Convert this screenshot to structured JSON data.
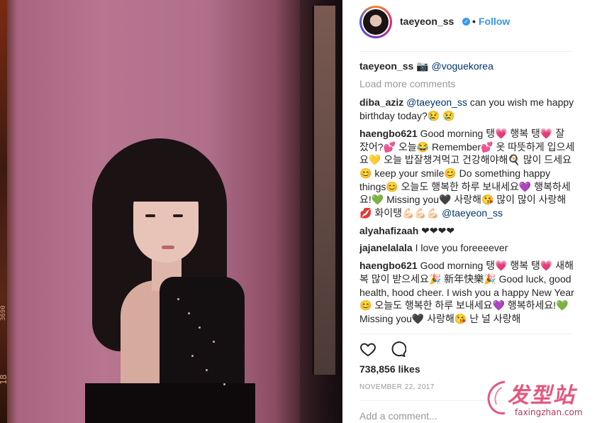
{
  "post": {
    "username": "taeyeon_ss",
    "follow_label": "Follow",
    "caption_user": "taeyeon_ss",
    "caption_emoji": "📷",
    "caption_mention": "@voguekorea",
    "load_more": "Load more comments",
    "likes": "738,856 likes",
    "date": "NOVEMBER 22, 2017",
    "add_comment_placeholder": "Add a comment..."
  },
  "comments": [
    {
      "user": "diba_aziz",
      "mention": "@taeyeon_ss",
      "text": " can you wish me happy birthday today?😢 😢"
    },
    {
      "user": "haengbo621",
      "text": " Good morning 탱💗 행복 탱💗 잘 잤어?💕 오늘😂 Remember💕 옷 따뜻하게 입으세요💛 오늘 밥잘챙겨먹고 건강해야해🍳 많이 드세요😊 keep your smile😊 Do something happy things😊 오늘도 행복한 하루 보내세요💜 행복하세요!💚 Missing you🖤 사랑해😘 많이 많이 사랑해💋 화이탱💪🏻💪🏻💪🏻 ",
      "mention": "@taeyeon_ss"
    },
    {
      "user": "alyahafizaah",
      "text": " ❤❤❤❤"
    },
    {
      "user": "jajanelalala",
      "text": " I love you foreeeever"
    },
    {
      "user": "haengbo621",
      "text": " Good morning 탱💗 행복 탱💗 새해 복 많이 받으세요🎉 新年快樂🎉 Good luck, good health, hood cheer. I wish you a happy New Year😊 오늘도 행복한 하루 보내세요💜 행복하세요!💚 Missing you🖤 사랑해😘 난 널 사랑해"
    }
  ],
  "watermark": {
    "logo": "发型站",
    "url": "faxingzhan.com"
  },
  "film": {
    "top_text": "3690",
    "bottom_text": "18"
  },
  "colors": {
    "accent": "#3897f0",
    "mention": "#003569",
    "muted": "#999999"
  },
  "icons": {
    "like": "heart-icon",
    "comment": "comment-bubble-icon",
    "verified": "verified-badge-icon"
  }
}
